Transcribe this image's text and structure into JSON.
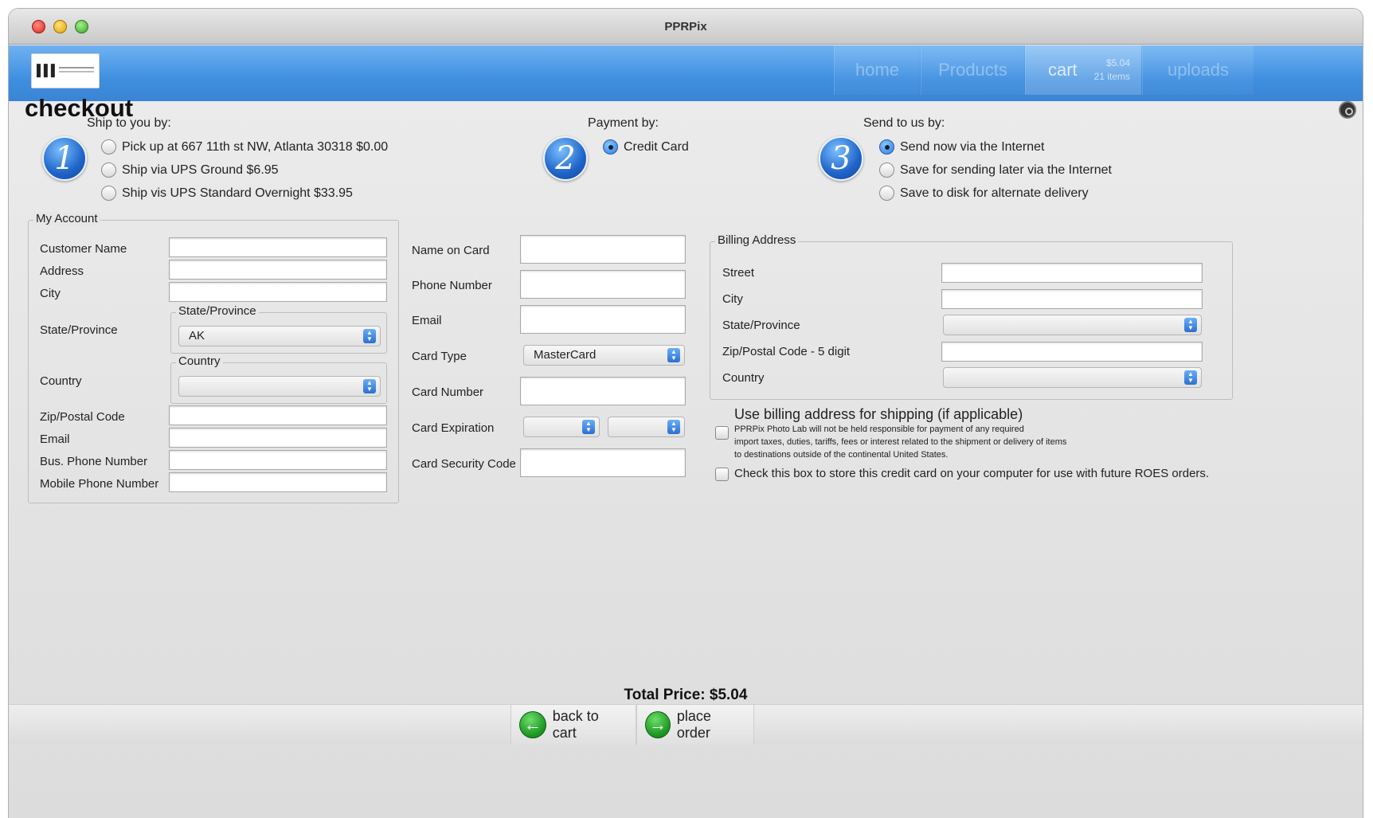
{
  "window": {
    "title": "PPRPix"
  },
  "nav": {
    "tabs": [
      {
        "label": "home"
      },
      {
        "label": "Products"
      },
      {
        "label": "cart"
      },
      {
        "label": "uploads"
      }
    ],
    "cart_total": "$5.04",
    "cart_items": "21 items"
  },
  "page": {
    "title": "checkout"
  },
  "ship": {
    "heading": "Ship to you by:",
    "step": "1",
    "options": [
      {
        "label": "Pick up at  667 11th st NW, Atlanta 30318 $0.00",
        "selected": false
      },
      {
        "label": "Ship via UPS Ground $6.95",
        "selected": false
      },
      {
        "label": "Ship vis UPS Standard Overnight $33.95",
        "selected": false
      }
    ]
  },
  "payment": {
    "heading": "Payment by:",
    "step": "2",
    "options": [
      {
        "label": "Credit Card",
        "selected": true
      }
    ]
  },
  "send": {
    "heading": "Send to us by:",
    "step": "3",
    "options": [
      {
        "label": "Send now via the Internet",
        "selected": true
      },
      {
        "label": "Save for sending later via the Internet",
        "selected": false
      },
      {
        "label": "Save to disk for alternate delivery",
        "selected": false
      }
    ]
  },
  "account": {
    "legend": "My Account",
    "customer_name_label": "Customer Name",
    "address_label": "Address",
    "city_label": "City",
    "state_label": "State/Province",
    "state_group_label": "State/Province",
    "state_value": "AK",
    "country_label": "Country",
    "country_group_label": "Country",
    "country_value": "",
    "zip_label": "Zip/Postal Code",
    "email_label": "Email",
    "bus_phone_label": "Bus. Phone Number",
    "mobile_phone_label": "Mobile Phone Number"
  },
  "card": {
    "name_label": "Name on Card",
    "phone_label": "Phone Number",
    "email_label": "Email",
    "type_label": "Card Type",
    "type_value": "MasterCard",
    "number_label": "Card Number",
    "expiration_label": "Card Expiration",
    "exp_month_value": "",
    "exp_year_value": "",
    "security_label": "Card Security Code"
  },
  "billing": {
    "legend": "Billing Address",
    "street_label": "Street",
    "city_label": "City",
    "state_label": "State/Province",
    "state_value": "",
    "zip_label": "Zip/Postal Code - 5 digit",
    "country_label": "Country",
    "country_value": ""
  },
  "options": {
    "use_billing_label": "Use billing address for shipping (if applicable)",
    "disclaimer_lines": [
      "PPRPix Photo Lab will not be held responsible for payment of any required",
      "import taxes, duties, tariffs, fees or interest related to the shipment or delivery of items",
      "to destinations outside of the continental United States."
    ],
    "store_card_label": "Check this box to store this credit card on your computer for use with future ROES orders."
  },
  "footer": {
    "total": "Total Price: $5.04",
    "back_label": "back to cart",
    "place_label": "place order"
  },
  "colors": {
    "nav_blue": "#3f8fe0",
    "step_blue": "#1f64c8",
    "action_green": "#1e9a24"
  }
}
